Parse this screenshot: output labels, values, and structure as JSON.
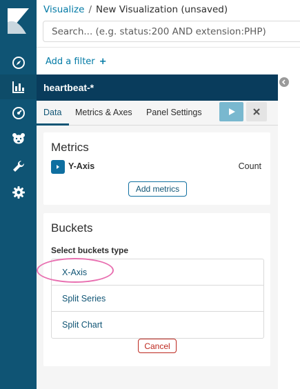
{
  "header": {
    "breadcrumb_root": "Visualize",
    "breadcrumb_sep": "/",
    "breadcrumb_current": "New Visualization (unsaved)",
    "search_placeholder": "Search... (e.g. status:200 AND extension:PHP)"
  },
  "filter": {
    "add_label": "Add a filter",
    "plus": "+"
  },
  "nav": {
    "items": [
      {
        "icon": "compass-icon"
      },
      {
        "icon": "bar-chart-icon",
        "active": true
      },
      {
        "icon": "dashboard-gauge-icon"
      },
      {
        "icon": "bear-icon"
      },
      {
        "icon": "wrench-icon"
      },
      {
        "icon": "gear-icon"
      }
    ]
  },
  "editor": {
    "index_pattern": "heartbeat-*",
    "tabs": [
      "Data",
      "Metrics & Axes",
      "Panel Settings"
    ],
    "active_tab": "Data",
    "metrics": {
      "title": "Metrics",
      "agg_label": "Y-Axis",
      "agg_value": "Count",
      "add_label": "Add metrics"
    },
    "buckets": {
      "title": "Buckets",
      "select_label": "Select buckets type",
      "types": [
        "X-Axis",
        "Split Series",
        "Split Chart"
      ],
      "cancel_label": "Cancel"
    }
  },
  "colors": {
    "nav_bg": "#0f5474",
    "index_bar_bg": "#093c5c",
    "link": "#0079a5",
    "apply_btn": "#79b8cf",
    "cancel": "#bd271e",
    "highlight": "#e86fb0"
  }
}
